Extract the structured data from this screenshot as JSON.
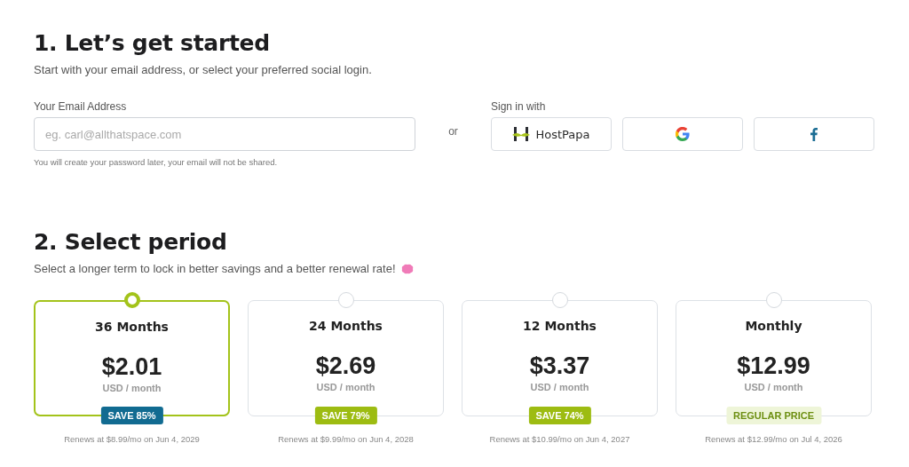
{
  "step1": {
    "title": "1. Let’s get started",
    "subtitle": "Start with your email address, or select your preferred social login.",
    "email": {
      "label": "Your Email Address",
      "placeholder": "eg. carl@allthatspace.com",
      "hint": "You will create your password later, your email will not be shared."
    },
    "or": "or",
    "social": {
      "label": "Sign in with",
      "buttons": [
        {
          "kind": "hostpapa",
          "label": "HostPapa"
        },
        {
          "kind": "google"
        },
        {
          "kind": "facebook"
        }
      ]
    }
  },
  "step2": {
    "title": "2. Select period",
    "subtitle": "Select a longer term to lock in better savings and a better renewal rate!",
    "plans": [
      {
        "name": "36 Months",
        "price": "$2.01",
        "unit": "USD / month",
        "badge": {
          "kind": "best",
          "label": "SAVE 85%"
        },
        "renews": "Renews at $8.99/mo on Jun 4, 2029",
        "selected": true
      },
      {
        "name": "24 Months",
        "price": "$2.69",
        "unit": "USD / month",
        "badge": {
          "kind": "save",
          "label": "SAVE 79%"
        },
        "renews": "Renews at $9.99/mo on Jun 4, 2028",
        "selected": false
      },
      {
        "name": "12 Months",
        "price": "$3.37",
        "unit": "USD / month",
        "badge": {
          "kind": "save",
          "label": "SAVE 74%"
        },
        "renews": "Renews at $10.99/mo on Jun 4, 2027",
        "selected": false
      },
      {
        "name": "Monthly",
        "price": "$12.99",
        "unit": "USD / month",
        "badge": {
          "kind": "regular",
          "label": "REGULAR PRICE"
        },
        "renews": "Renews at $12.99/mo on Jul 4, 2026",
        "selected": false
      }
    ]
  }
}
